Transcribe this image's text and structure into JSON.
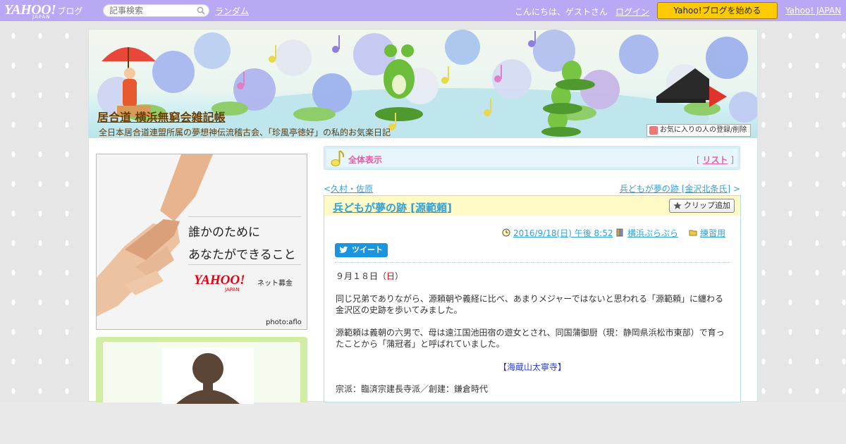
{
  "topbar": {
    "logo_main": "YAHOO!",
    "logo_sub": "JAPAN",
    "logo_blog": "ブログ",
    "search_placeholder": "記事検索",
    "random_label": "ランダム",
    "greeting": "こんにちは、ゲストさん",
    "login_label": "ログイン",
    "start_blog_label": "Yahoo!ブログを始める",
    "yahoo_japan_label": "Yahoo! JAPAN"
  },
  "header": {
    "blog_title": "居合道 横浜無窮会雑記帳",
    "blog_desc": "全日本居合道連盟所属の夢想神伝流稽古会、「珍風亭徳好」の私的お気楽日記",
    "fav_label": "お気に入りの人の登録/削除"
  },
  "sidebar": {
    "ad_line1": "誰かのために",
    "ad_line2": "あなたができること",
    "ad_logo": "YAHOO!",
    "ad_logo_sub": "JAPAN",
    "ad_brand": "ネット募金",
    "ad_credit": "photo:aflo"
  },
  "main": {
    "view_title": "全体表示",
    "list_open": "[",
    "list_label": "リスト",
    "list_close": "]",
    "prev_arrow": "<",
    "prev_label": "久村・佐原",
    "next_label": "兵どもが夢の跡 [金沢北条氏]",
    "next_arrow": ">",
    "article": {
      "title": "兵どもが夢の跡 [源範頼]",
      "clip_label": "クリップ追加",
      "date": "2016/9/18(日) 午後 8:52",
      "author": "横浜ぷらぷら",
      "category": "練習用",
      "tweet_label": "ツイート",
      "date_line_pre": "９月１８日（",
      "date_line_day": "日",
      "date_line_post": "）",
      "para1": "同じ兄弟でありながら、源頼朝や義経に比べ、あまりメジャーではないと思われる「源範頼」に纏わる金沢区の史跡を歩いてみました。",
      "para2": "源範頼は義朝の六男で、母は遠江国池田宿の遊女とされ、同国蒲御厨（現：静岡県浜松市東部）で育ったことから「蒲冠者」と呼ばれていました。",
      "section_heading": "【海蔵山太寧寺】",
      "para3": "宗派：臨済宗建長寺派／創建：鎌倉時代"
    }
  },
  "colors": {
    "topbar": "#b9a9f5",
    "start_button": "#fecb00",
    "title_brown": "#6b3c00",
    "link_blue": "#31a2d8",
    "pink": "#e85aa5",
    "profile_green": "#cfeea4"
  }
}
